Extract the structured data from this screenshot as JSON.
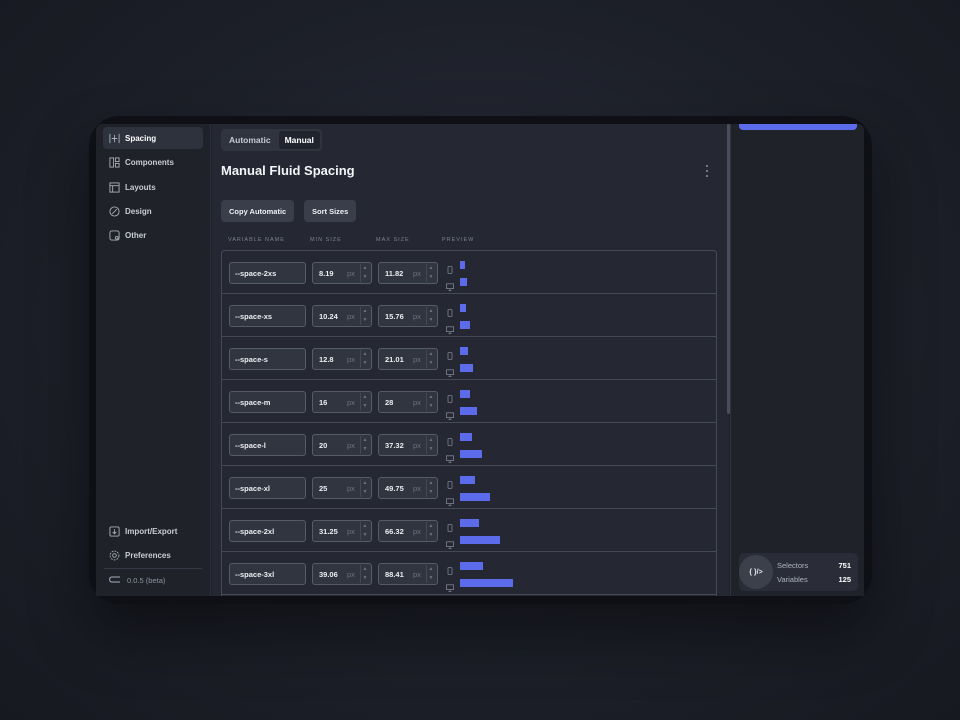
{
  "sidebar": {
    "items": [
      {
        "label": "Spacing",
        "icon": "spacing-icon"
      },
      {
        "label": "Components",
        "icon": "components-icon"
      },
      {
        "label": "Layouts",
        "icon": "layouts-icon"
      },
      {
        "label": "Design",
        "icon": "design-icon"
      },
      {
        "label": "Other",
        "icon": "other-icon"
      }
    ],
    "footer": [
      {
        "label": "Import/Export",
        "icon": "import-export-icon"
      },
      {
        "label": "Preferences",
        "icon": "gear-icon"
      }
    ],
    "version": "0.0.5 (beta)"
  },
  "main": {
    "tabs": [
      {
        "label": "Automatic",
        "active": false
      },
      {
        "label": "Manual",
        "active": true
      }
    ],
    "title": "Manual Fluid Spacing",
    "buttons": {
      "copy": "Copy Automatic",
      "sort": "Sort Sizes"
    },
    "columns": {
      "name": "VARIABLE NAME",
      "min": "MIN SIZE",
      "max": "MAX SIZE",
      "preview": "PREVIEW"
    },
    "unit": "px",
    "rows": [
      {
        "name": "--space-2xs",
        "min": "8.19",
        "max": "11.82"
      },
      {
        "name": "--space-xs",
        "min": "10.24",
        "max": "15.76"
      },
      {
        "name": "--space-s",
        "min": "12.8",
        "max": "21.01"
      },
      {
        "name": "--space-m",
        "min": "16",
        "max": "28"
      },
      {
        "name": "--space-l",
        "min": "20",
        "max": "37.32"
      },
      {
        "name": "--space-xl",
        "min": "25",
        "max": "49.75"
      },
      {
        "name": "--space-2xl",
        "min": "31.25",
        "max": "66.32"
      },
      {
        "name": "--space-3xl",
        "min": "39.06",
        "max": "88.41"
      }
    ]
  },
  "stats": {
    "selectors_label": "Selectors",
    "selectors_value": "751",
    "variables_label": "Variables",
    "variables_value": "125"
  },
  "colors": {
    "accent": "#5b6bea"
  }
}
